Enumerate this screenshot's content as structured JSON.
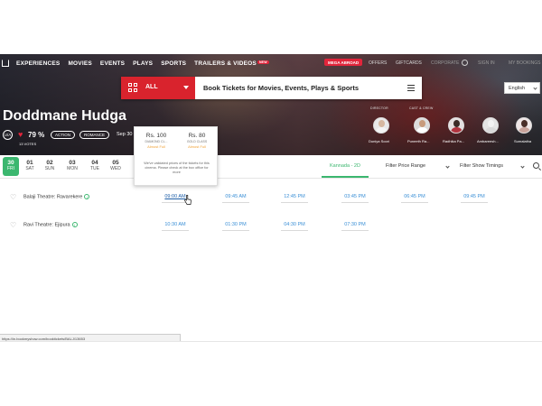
{
  "nav": {
    "items": [
      "EXPERIENCES",
      "MOVIES",
      "EVENTS",
      "PLAYS",
      "SPORTS",
      "TRAILERS & VIDEOS"
    ],
    "new_badge": "NEW",
    "mwd_label": "MEGA ABROAD",
    "right_items": [
      "OFFERS",
      "GIFTCARDS",
      "CORPORATE",
      "SIGN IN",
      "MY BOOKINGS"
    ]
  },
  "search": {
    "category": "ALL",
    "placeholder": "Book Tickets for Movies, Events, Plays & Sports"
  },
  "language": "English",
  "movie": {
    "title": "Doddmane Hudga",
    "certificate": "U/A",
    "rating": "79 %",
    "votes": "13 VOTES",
    "genres": [
      "ACTION",
      "ROMANCE"
    ],
    "date": "Sep 30"
  },
  "crew": {
    "director_heading": "DIRECTOR",
    "cast_heading": "CAST & CREW",
    "members": [
      {
        "name": "Duniya Soori"
      },
      {
        "name": "Puneeth Ra..."
      },
      {
        "name": "Radhika Pa..."
      },
      {
        "name": "Ambareesh..."
      },
      {
        "name": "Sumalatha"
      }
    ]
  },
  "dates": [
    {
      "num": "30",
      "day": "FRI"
    },
    {
      "num": "01",
      "day": "SAT"
    },
    {
      "num": "02",
      "day": "SUN"
    },
    {
      "num": "03",
      "day": "MON"
    },
    {
      "num": "04",
      "day": "TUE"
    },
    {
      "num": "05",
      "day": "WED"
    }
  ],
  "filters": {
    "language": "Kannada - 2D",
    "price": "Filter Price Range",
    "timings": "Filter Show Timings"
  },
  "venues": [
    {
      "name": "Balaji Theatre: Ravarekere",
      "times": [
        "09:00 AM",
        "09:45 AM",
        "12:45 PM",
        "03:45 PM",
        "06:45 PM",
        "09:45 PM"
      ]
    },
    {
      "name": "Ravi Theatre: Ejipura",
      "times": [
        "10:30 AM",
        "01:30 PM",
        "04:30 PM",
        "07:30 PM"
      ]
    }
  ],
  "tooltip": {
    "prices": [
      {
        "price": "Rs. 100",
        "class": "DIAMOND CL...",
        "status": "Almost Full"
      },
      {
        "price": "Rs. 80",
        "class": "GOLD CLASS",
        "status": "Almost Full"
      }
    ],
    "note": "We've validated prices of the tickets for this cinema. Please check at the box office for more"
  },
  "status_url": "https://in.bookmyshow.com/booktickets/BALJ/13653",
  "colors": {
    "accent_green": "#3bb76f",
    "brand_red": "#d9232d",
    "link_blue": "#3a8fd6",
    "almost_full": "#f0a33a"
  }
}
